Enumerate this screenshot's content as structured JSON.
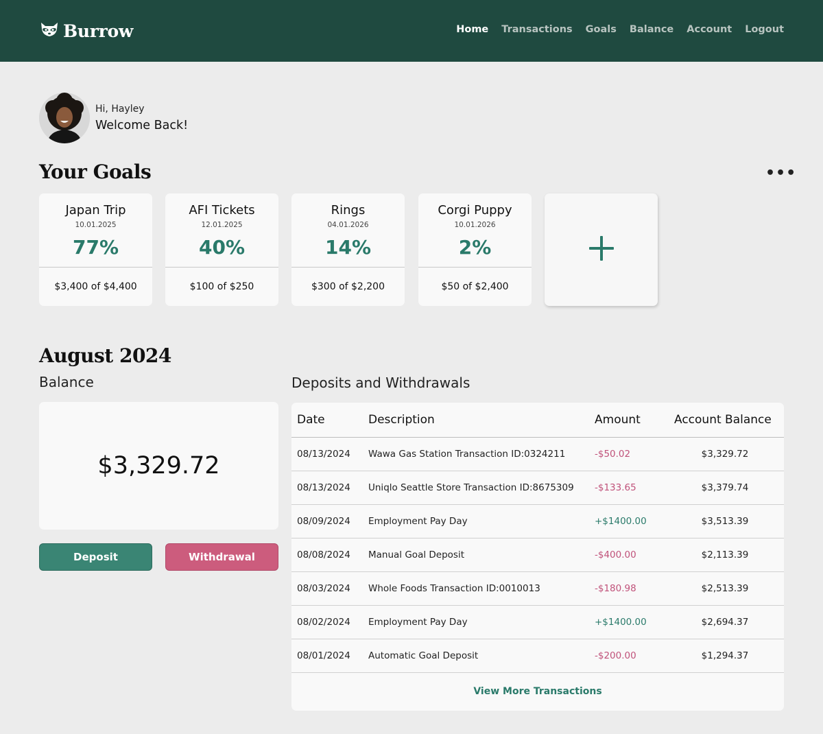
{
  "brand": {
    "name": "Burrow",
    "logo_icon": "raccoon-icon"
  },
  "nav": [
    "Home",
    "Transactions",
    "Goals",
    "Balance",
    "Account",
    "Logout"
  ],
  "user": {
    "greeting": "Hi, Hayley",
    "welcome": "Welcome Back!"
  },
  "goals": {
    "title": "Your Goals",
    "more_icon": "ellipsis-icon",
    "items": [
      {
        "name": "Japan Trip",
        "date": "10.01.2025",
        "percent": "77%",
        "amount": "$3,400 of $4,400"
      },
      {
        "name": "AFI Tickets",
        "date": "12.01.2025",
        "percent": "40%",
        "amount": "$100 of $250"
      },
      {
        "name": "Rings",
        "date": "04.01.2026",
        "percent": "14%",
        "amount": "$300 of $2,200"
      },
      {
        "name": "Corgi Puppy",
        "date": "10.01.2026",
        "percent": "2%",
        "amount": "$50 of $2,400"
      }
    ],
    "add_icon": "plus-icon"
  },
  "month": {
    "title": "August 2024",
    "balance_label": "Balance",
    "balance_value": "$3,329.72",
    "deposit_label": "Deposit",
    "withdrawal_label": "Withdrawal"
  },
  "transactions": {
    "title": "Deposits and Withdrawals",
    "columns": [
      "Date",
      "Description",
      "Amount",
      "Account Balance"
    ],
    "rows": [
      {
        "date": "08/13/2024",
        "description": "Wawa Gas Station Transaction ID:0324211",
        "amount": "-$50.02",
        "balance": "$3,329.72"
      },
      {
        "date": "08/13/2024",
        "description": "Uniqlo Seattle Store Transaction ID:8675309",
        "amount": "-$133.65",
        "balance": "$3,379.74"
      },
      {
        "date": "08/09/2024",
        "description": "Employment Pay Day",
        "amount": "+$1400.00",
        "balance": "$3,513.39"
      },
      {
        "date": "08/08/2024",
        "description": "Manual Goal Deposit",
        "amount": "-$400.00",
        "balance": "$2,113.39"
      },
      {
        "date": "08/03/2024",
        "description": "Whole Foods Transaction ID:0010013",
        "amount": "-$180.98",
        "balance": "$2,513.39"
      },
      {
        "date": "08/02/2024",
        "description": "Employment Pay Day",
        "amount": "+$1400.00",
        "balance": "$2,694.37"
      },
      {
        "date": "08/01/2024",
        "description": "Automatic Goal Deposit",
        "amount": "-$200.00",
        "balance": "$1,294.37"
      }
    ],
    "view_more": "View More Transactions"
  },
  "colors": {
    "header_bg": "#1f4a40",
    "accent_green": "#2a7a6a",
    "deposit_button": "#3a8574",
    "withdrawal_button": "#cc5c7d",
    "negative_amount": "#c0527a",
    "page_bg": "#ececec"
  }
}
